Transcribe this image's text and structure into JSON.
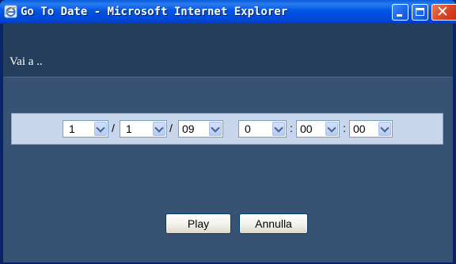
{
  "window": {
    "title": "Go To Date - Microsoft Internet Explorer"
  },
  "header": {
    "title": "Vai a .."
  },
  "date_time": {
    "day": {
      "value": "1"
    },
    "month": {
      "value": "1"
    },
    "year": {
      "value": "09"
    },
    "hour": {
      "value": "0"
    },
    "minute": {
      "value": "00"
    },
    "second": {
      "value": "00"
    },
    "date_separator": "/",
    "time_separator": ":"
  },
  "buttons": {
    "play_label": "Play",
    "cancel_label": "Annulla"
  },
  "colors": {
    "content_background": "#375272",
    "header_background": "#253E5B",
    "date_panel_background": "#C8D6EB"
  }
}
